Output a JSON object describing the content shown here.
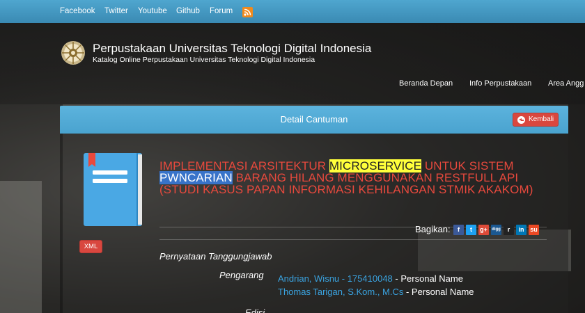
{
  "topbar": {
    "links": [
      "Facebook",
      "Twitter",
      "Youtube",
      "Github",
      "Forum"
    ],
    "rss_icon": "rss-icon"
  },
  "header": {
    "title": "Perpustakaan Universitas Teknologi Digital Indonesia",
    "subtitle": "Katalog Online Perpustakaan Universitas Teknologi Digital Indonesia",
    "logo_icon": "university-seal-icon"
  },
  "nav": {
    "items": [
      "Beranda Depan",
      "Info Perpustakaan",
      "Area Angg"
    ]
  },
  "panel": {
    "title": "Detail Cantuman",
    "back_label": "Kembali"
  },
  "record": {
    "xml_label": "XML",
    "title_parts": {
      "p1": "IMPLEMENTASI ARSITEKTUR ",
      "hl1": "MICROSERVICE",
      "p2": " UNTUK SISTEM ",
      "hl2": "PWNCARIAN",
      "p3": " BARANG HILANG MENGGUNAKAN RESTFULL API (STUDI KASUS PAPAN INFORMASI KEHILANGAN STMIK AKAKOM)"
    },
    "share_label": "Bagikan:",
    "share_icons": [
      {
        "name": "facebook-icon",
        "glyph": "f",
        "color": "#3b5998"
      },
      {
        "name": "twitter-icon",
        "glyph": "t",
        "color": "#1da1f2"
      },
      {
        "name": "google-plus-icon",
        "glyph": "g+",
        "color": "#dd4b39"
      },
      {
        "name": "digg-icon",
        "glyph": "digg",
        "color": "#1b5891"
      },
      {
        "name": "reddit-icon",
        "glyph": "r",
        "color": "#222222"
      },
      {
        "name": "linkedin-icon",
        "glyph": "in",
        "color": "#0077b5"
      },
      {
        "name": "stumbleupon-icon",
        "glyph": "su",
        "color": "#eb4924"
      }
    ],
    "statement_label": "Pernyataan Tanggungjawab",
    "author_label": "Pengarang",
    "authors": [
      {
        "name": "Andrian, Wisnu - 175410048",
        "role": " - Personal Name"
      },
      {
        "name": "Thomas Tarigan, S.Kom., M.Cs",
        "role": " - Personal Name"
      }
    ],
    "edition_label": "Edisi"
  }
}
